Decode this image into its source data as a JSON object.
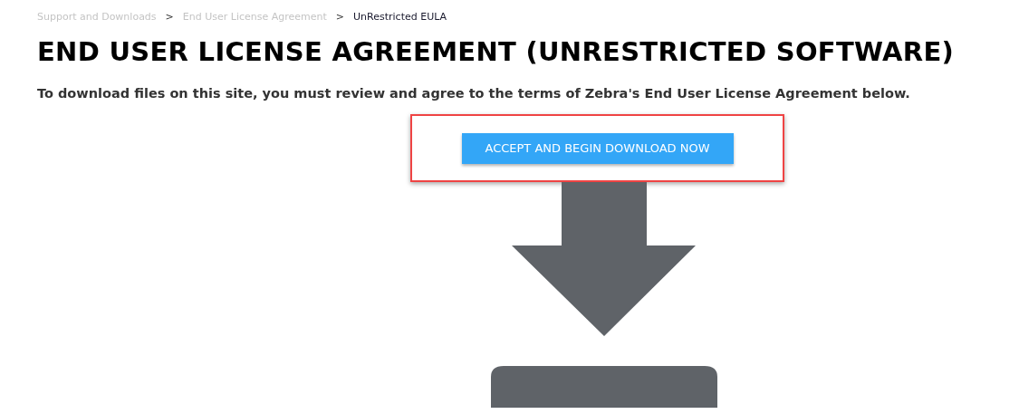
{
  "breadcrumb": {
    "items": [
      {
        "label": "Support and Downloads",
        "current": false
      },
      {
        "label": "End User License Agreement",
        "current": false
      },
      {
        "label": "UnRestricted EULA",
        "current": true
      }
    ],
    "separators": [
      ">",
      ">"
    ]
  },
  "title": "END USER LICENSE AGREEMENT (UNRESTRICTED SOFTWARE)",
  "intro": "To download files on this site, you must review and agree to the terms of Zebra's End User License Agreement below.",
  "accept_button": "ACCEPT AND BEGIN DOWNLOAD NOW"
}
